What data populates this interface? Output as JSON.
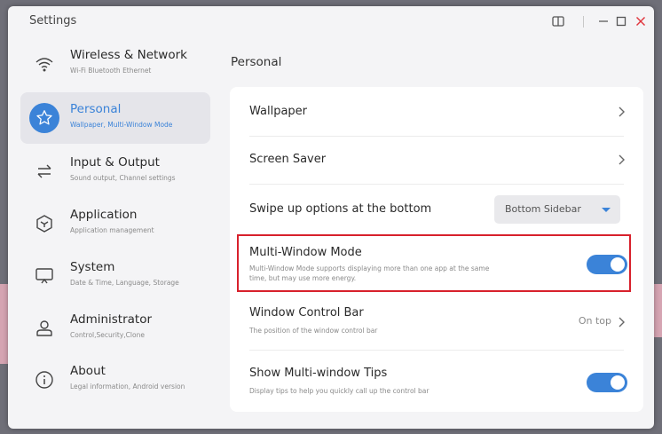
{
  "window": {
    "title": "Settings"
  },
  "titlebar": {
    "buttons": [
      "layout-icon",
      "minimize-icon",
      "maximize-icon",
      "close-icon"
    ],
    "close_color": "#e0343c"
  },
  "sidebar": {
    "items": [
      {
        "title": "Wireless & Network",
        "subtitle": "Wi-Fi Bluetooth Ethernet",
        "icon": "wifi-icon",
        "active": false
      },
      {
        "title": "Personal",
        "subtitle": "Wallpaper, Multi-Window Mode",
        "icon": "star-icon",
        "active": true
      },
      {
        "title": "Input & Output",
        "subtitle": "Sound output, Channel settings",
        "icon": "swap-arrows-icon",
        "active": false
      },
      {
        "title": "Application",
        "subtitle": "Application management",
        "icon": "cube-icon",
        "active": false
      },
      {
        "title": "System",
        "subtitle": "Date & Time, Language, Storage",
        "icon": "monitor-icon",
        "active": false
      },
      {
        "title": "Administrator",
        "subtitle": "Control,Security,Clone",
        "icon": "user-icon",
        "active": false
      },
      {
        "title": "About",
        "subtitle": "Legal information, Android version",
        "icon": "info-icon",
        "active": false
      }
    ]
  },
  "main": {
    "title": "Personal",
    "rows": {
      "wallpaper": {
        "label": "Wallpaper"
      },
      "screen_saver": {
        "label": "Screen Saver"
      },
      "swipe_up": {
        "label": "Swipe up options at the bottom",
        "value": "Bottom Sidebar"
      },
      "multi_window": {
        "label": "Multi-Window Mode",
        "description": "Multi-Window Mode supports displaying more than one app at the same time, but may use more energy.",
        "enabled": true
      },
      "window_control_bar": {
        "label": "Window Control Bar",
        "description": "The position of the window control bar",
        "value": "On top"
      },
      "multi_window_tips": {
        "label": "Show Multi-window Tips",
        "description": "Display tips to help you quickly call up the control bar",
        "enabled": true
      }
    }
  },
  "colors": {
    "accent": "#3b83d8",
    "highlight": "#d8212c"
  }
}
